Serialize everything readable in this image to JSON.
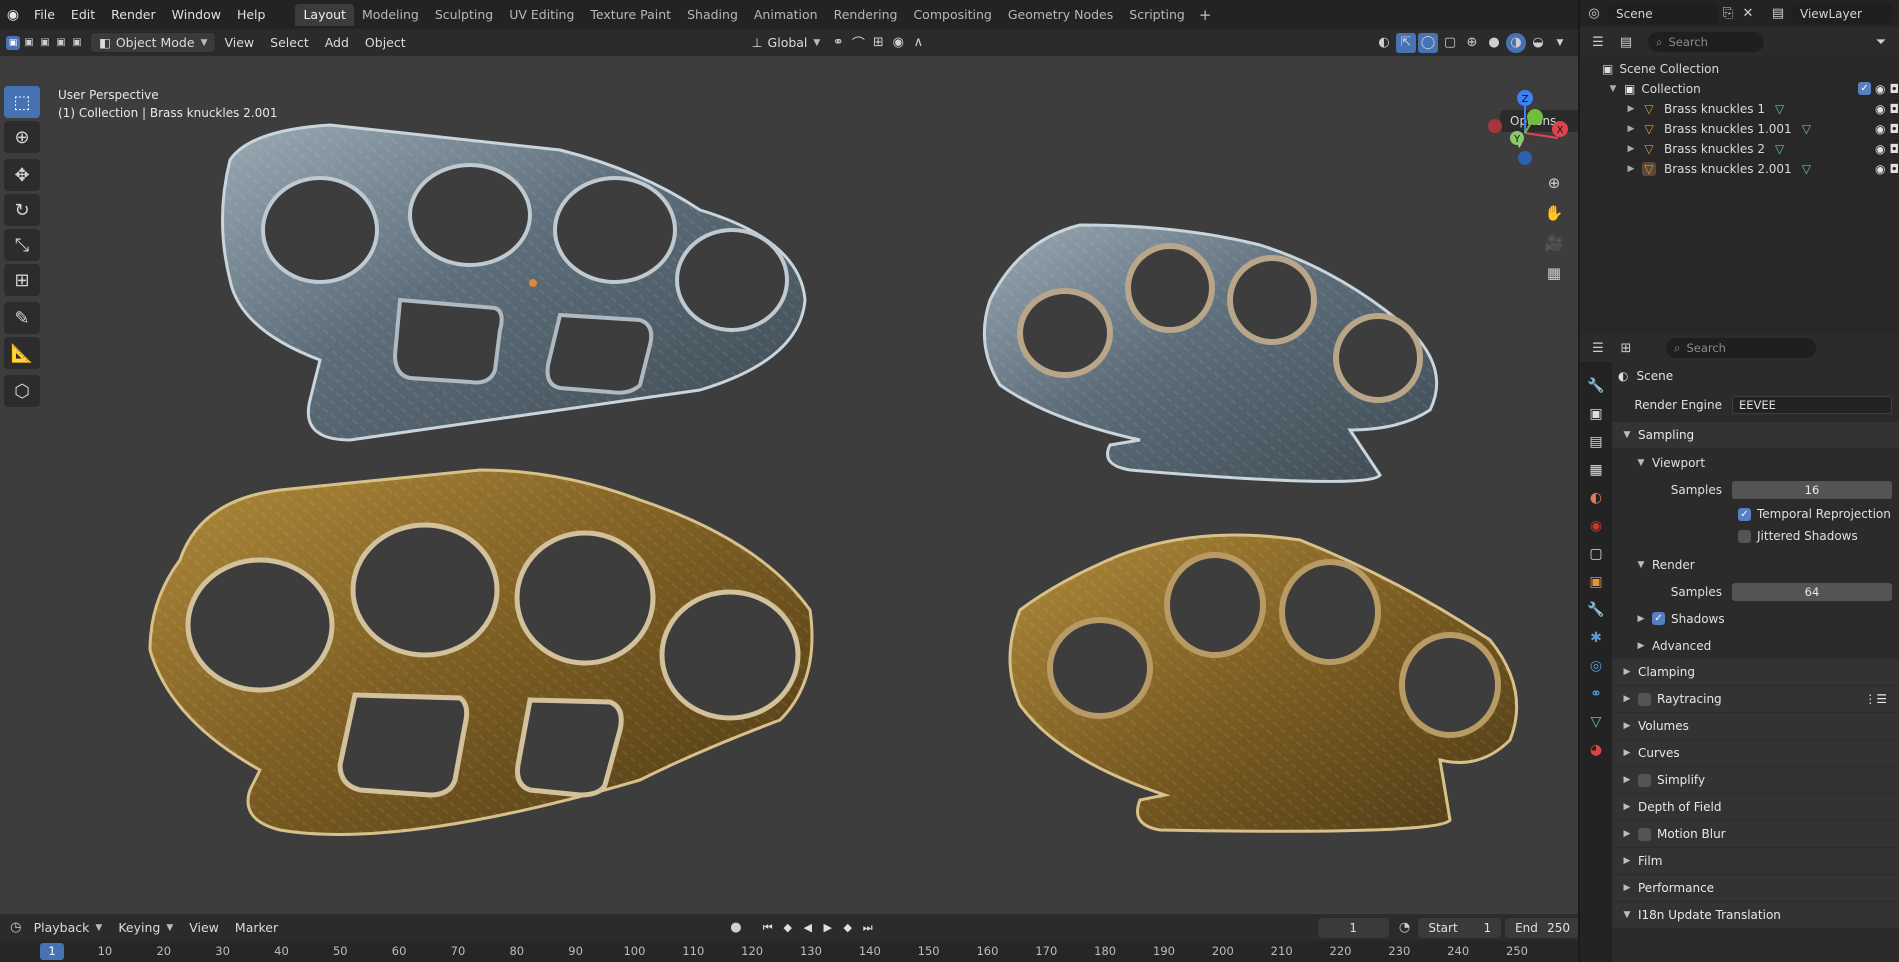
{
  "menus": [
    "File",
    "Edit",
    "Render",
    "Window",
    "Help"
  ],
  "workspaces": [
    "Layout",
    "Modeling",
    "Sculpting",
    "UV Editing",
    "Texture Paint",
    "Shading",
    "Animation",
    "Rendering",
    "Compositing",
    "Geometry Nodes",
    "Scripting"
  ],
  "active_workspace": "Layout",
  "scene_name": "Scene",
  "view_layer": "ViewLayer",
  "viewport_header": {
    "mode": "Object Mode",
    "menus": [
      "View",
      "Select",
      "Add",
      "Object"
    ],
    "transform_orientation": "Global",
    "options": "Options"
  },
  "viewport_info": {
    "line1": "User Perspective",
    "line2": "(1) Collection | Brass knuckles 2.001"
  },
  "gizmo_axes": {
    "x": "X",
    "y": "Y",
    "z": "Z"
  },
  "outliner": {
    "search_placeholder": "Search",
    "scene_collection": "Scene Collection",
    "collection": "Collection",
    "objects": [
      "Brass knuckles 1",
      "Brass knuckles 1.001",
      "Brass knuckles 2",
      "Brass knuckles 2.001"
    ]
  },
  "properties": {
    "search_placeholder": "Search",
    "context": "Scene",
    "render_engine_label": "Render Engine",
    "render_engine": "EEVEE",
    "sampling": "Sampling",
    "viewport": "Viewport",
    "samples_label": "Samples",
    "viewport_samples": "16",
    "temporal_reprojection": "Temporal Reprojection",
    "jittered_shadows": "Jittered Shadows",
    "render": "Render",
    "render_samples": "64",
    "shadows": "Shadows",
    "advanced": "Advanced",
    "panels": [
      "Clamping",
      "Raytracing",
      "Volumes",
      "Curves",
      "Simplify",
      "Depth of Field",
      "Motion Blur",
      "Film",
      "Performance",
      "I18n Update Translation"
    ]
  },
  "timeline": {
    "menus": [
      "Playback",
      "Keying",
      "View",
      "Marker"
    ],
    "current_frame": "1",
    "start_label": "Start",
    "start": "1",
    "end_label": "End",
    "end": "250",
    "ticks": [
      "1",
      "10",
      "20",
      "30",
      "40",
      "50",
      "60",
      "70",
      "80",
      "90",
      "100",
      "110",
      "120",
      "130",
      "140",
      "150",
      "160",
      "170",
      "180",
      "190",
      "200",
      "210",
      "220",
      "230",
      "240",
      "250"
    ]
  },
  "colors": {
    "accent": "#4772b3",
    "object_icon": "#e8923c",
    "mesh_icon": "#5ec994",
    "steel": "#6a7a86",
    "brass": "#8a6a2a"
  }
}
